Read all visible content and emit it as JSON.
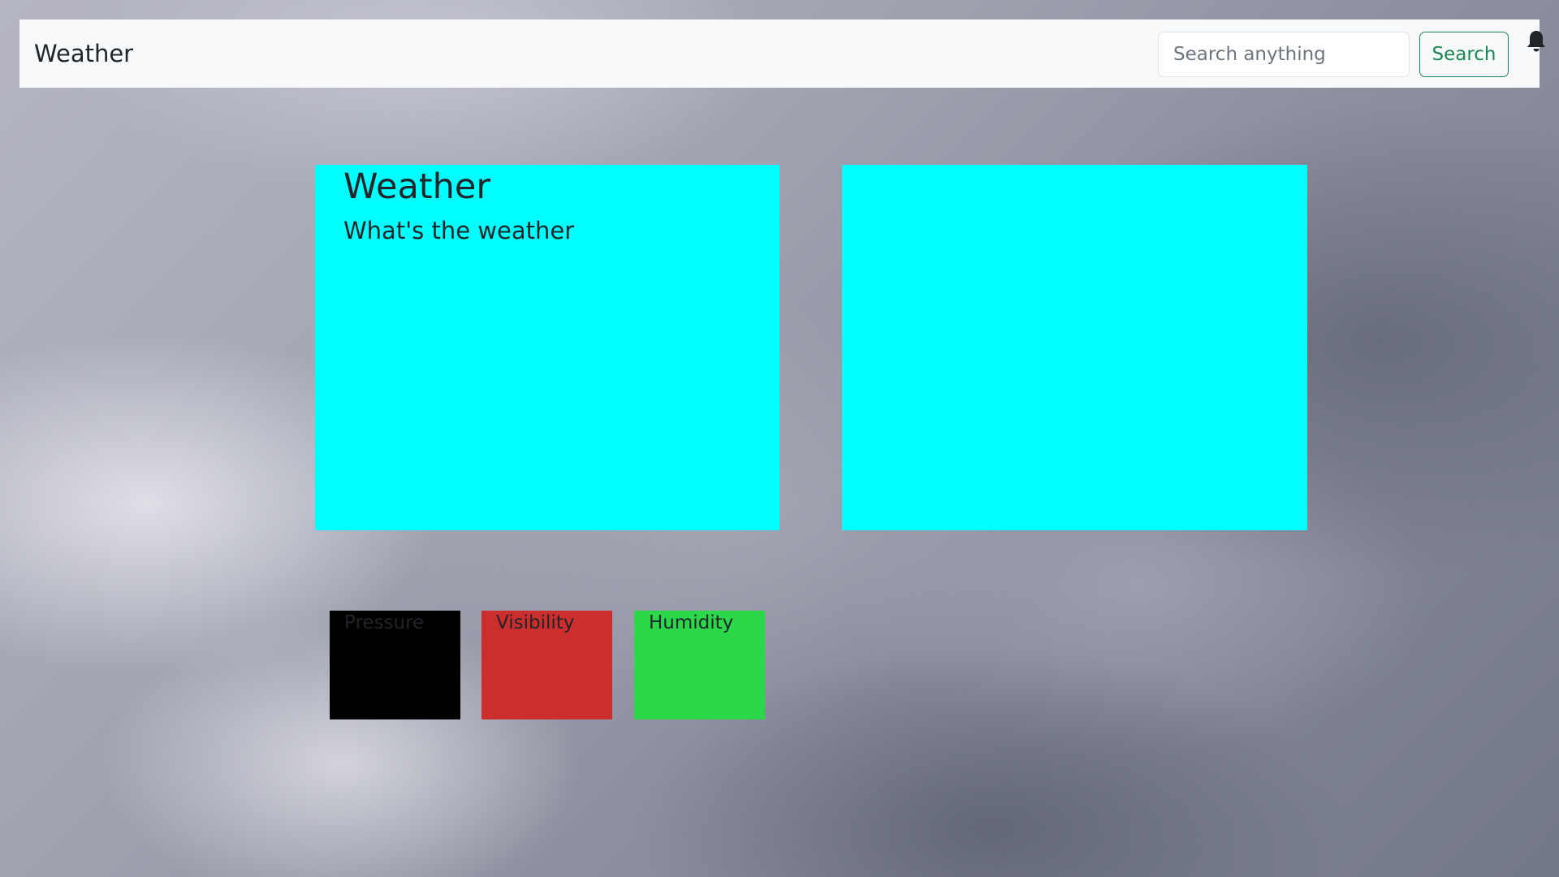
{
  "navbar": {
    "brand": "Weather",
    "search_placeholder": "Search anything",
    "search_value": "",
    "search_button_label": "Search",
    "notification_icon": "bell-icon"
  },
  "main_card": {
    "title": "Weather",
    "subtitle": "What's the weather"
  },
  "stats": {
    "pressure_label": "Pressure",
    "visibility_label": "Visibility",
    "humidity_label": "Humidity"
  },
  "colors": {
    "card": "#00ffff",
    "pressure": "#000000",
    "visibility": "#cc2e2e",
    "humidity": "#2bd84a",
    "search_button": "#198754"
  }
}
